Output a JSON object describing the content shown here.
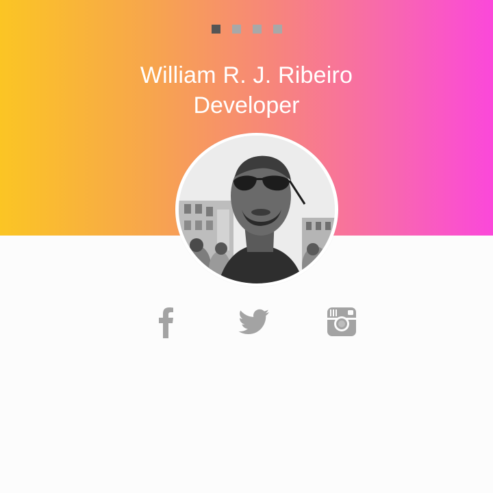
{
  "slider": {
    "dots": [
      {
        "label": "slide-1",
        "active": true
      },
      {
        "label": "slide-2",
        "active": false
      },
      {
        "label": "slide-3",
        "active": false
      },
      {
        "label": "slide-4",
        "active": false
      }
    ]
  },
  "profile": {
    "name": "William R. J. Ribeiro",
    "role": "Developer"
  },
  "social": {
    "icons": [
      "facebook-icon",
      "twitter-icon",
      "instagram-icon"
    ]
  },
  "colors": {
    "gradient_start": "#fbc524",
    "gradient_end": "#fb48da",
    "icon_gray": "#a3a3a3",
    "active_dot": "#555555",
    "inactive_dot": "#a8a8a8",
    "background": "#fcfcfc"
  }
}
